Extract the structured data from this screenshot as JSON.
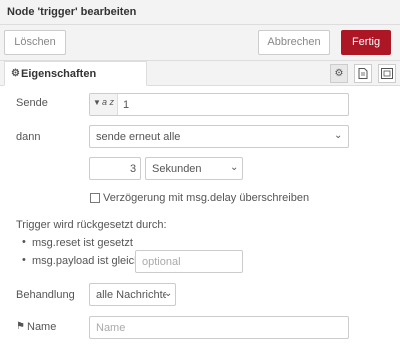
{
  "tray": {
    "title": "Node 'trigger' bearbeiten",
    "buttons": {
      "delete": "Löschen",
      "cancel": "Abbrechen",
      "done": "Fertig"
    }
  },
  "tabs": {
    "properties_label": "Eigenschaften"
  },
  "form": {
    "send_label": "Sende",
    "send_value": "1",
    "send_type_icon": "a z",
    "then_label": "dann",
    "then_value": "sende erneut alle",
    "interval_value": "3",
    "interval_unit": "Sekunden",
    "override_delay_label": "Verzögerung mit msg.delay überschreiben",
    "reset_heading": "Trigger wird rückgesetzt durch:",
    "reset_items": {
      "reset_prop": "msg.reset ist gesetzt",
      "payload_prop": "msg.payload ist gleich"
    },
    "payload_placeholder": "optional",
    "handling_label": "Behandlung",
    "handling_value": "alle Nachrichte",
    "name_label": "Name",
    "name_placeholder": "Name"
  },
  "colors": {
    "accent": "#ad1625",
    "header_bg": "#f3f3f3"
  }
}
